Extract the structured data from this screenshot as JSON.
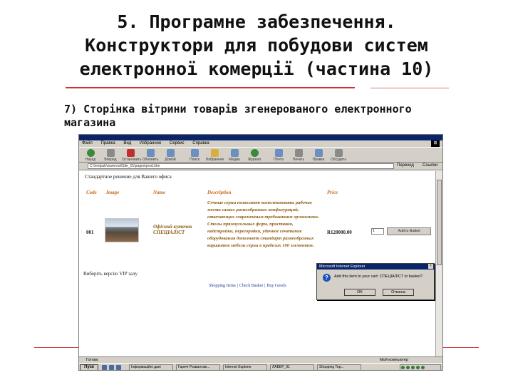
{
  "slide": {
    "title_lines": [
      "5. Програмне забезпечення.",
      "Конструктори для побудови систем",
      "електронної комерції (частина 10)"
    ],
    "subtitle_lines": [
      "7) Сторінка вітрини товарів згенерованого електронного",
      "магазина"
    ]
  },
  "browser": {
    "menu": [
      "Файл",
      "Правка",
      "Вид",
      "Избранное",
      "Сервис",
      "Справка"
    ],
    "toolbar": [
      "Назад",
      "Вперед",
      "Остановить",
      "Обновить",
      "Домой",
      "Поиск",
      "Избранное",
      "Медиа",
      "Журнал",
      "Почта",
      "Печать",
      "Правка",
      "Обсудить"
    ],
    "address_value": "C:\\Inetpub\\wwwroot\\Site_01\\pages\\prod.htm",
    "go_label": "Переход",
    "links_label": "Ссылки"
  },
  "store": {
    "heading": "Стандартное решение для Вашего офиса",
    "columns": {
      "code": "Code",
      "image": "Image",
      "name": "Name",
      "description": "Description",
      "price": "Price"
    },
    "product": {
      "code": "001",
      "name": "Офісний куточок СПЕЦІАЛІСТ",
      "description": "Сочные серии позволяют комплектовать рабочие места самых разнообразных конфигураций, отвечающих современным требованиям эргономики. Столы прямоугольных форм, приставки, надстройки, перегородки, удачное сочетание оборудования дополняет стандарт разнообразных вариантов мебели серии в пределах 100 элементов.",
      "price": "R120000.00",
      "qty": "1",
      "add_button": "Add to Basket"
    },
    "vip_link": "Виберіть версію VIP залу",
    "footer": [
      "Shopping Items",
      "Check Basket",
      "Buy Goods"
    ]
  },
  "dialog": {
    "title": "Microsoft Internet Explorer",
    "message": "Add this item to your cart: СПЕЦІАЛІСТ to basket?",
    "ok": "OK",
    "cancel": "Отмена"
  },
  "status": {
    "left": "Готово",
    "right": "Мой компьютер"
  },
  "taskbar": {
    "start": "Пуск",
    "tasks": [
      "Інформаційні дані",
      "Гарячі Розвантаж...",
      "Internet Explorer",
      "ЛАБЕР_01",
      "Shopping Top..."
    ]
  }
}
